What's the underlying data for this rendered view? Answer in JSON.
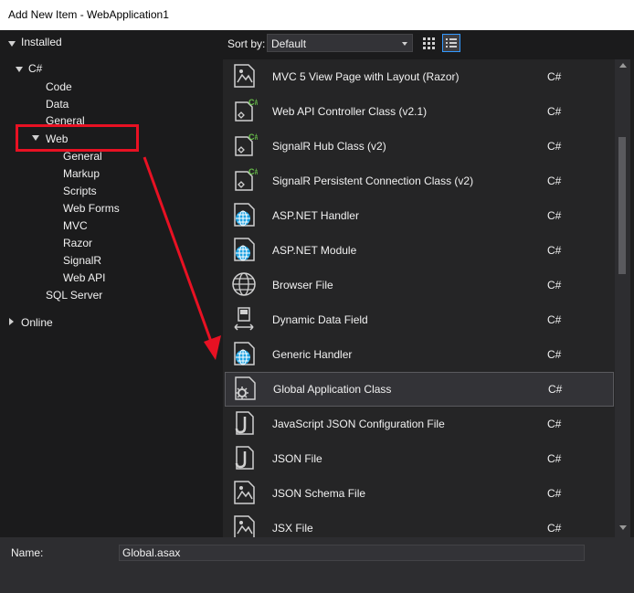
{
  "window": {
    "title": "Add New Item - WebApplication1"
  },
  "tree": {
    "installed": "Installed",
    "csharp": "C#",
    "code": "Code",
    "data": "Data",
    "general": "General",
    "web": "Web",
    "web_children": [
      "General",
      "Markup",
      "Scripts",
      "Web Forms",
      "MVC",
      "Razor",
      "SignalR",
      "Web API"
    ],
    "sql_server": "SQL Server",
    "online": "Online"
  },
  "toolbar": {
    "sort_label": "Sort by:",
    "sort_value": "Default"
  },
  "items": [
    {
      "name": "MVC 5 View Page with Layout (Razor)",
      "lang": "C#",
      "icon": "razor-page-icon"
    },
    {
      "name": "Web API Controller Class (v2.1)",
      "lang": "C#",
      "icon": "csharp-class-icon"
    },
    {
      "name": "SignalR Hub Class (v2)",
      "lang": "C#",
      "icon": "csharp-class-icon"
    },
    {
      "name": "SignalR Persistent Connection Class (v2)",
      "lang": "C#",
      "icon": "csharp-class-icon"
    },
    {
      "name": "ASP.NET Handler",
      "lang": "C#",
      "icon": "globe-page-icon"
    },
    {
      "name": "ASP.NET Module",
      "lang": "C#",
      "icon": "globe-page-icon"
    },
    {
      "name": "Browser File",
      "lang": "C#",
      "icon": "globe-icon"
    },
    {
      "name": "Dynamic Data Field",
      "lang": "C#",
      "icon": "dynamic-field-icon"
    },
    {
      "name": "Generic Handler",
      "lang": "C#",
      "icon": "globe-page-icon"
    },
    {
      "name": "Global Application Class",
      "lang": "C#",
      "icon": "gear-page-icon"
    },
    {
      "name": "JavaScript JSON Configuration File",
      "lang": "C#",
      "icon": "json-file-icon"
    },
    {
      "name": "JSON File",
      "lang": "C#",
      "icon": "json-file-icon"
    },
    {
      "name": "JSON Schema File",
      "lang": "C#",
      "icon": "razor-page-icon"
    },
    {
      "name": "JSX File",
      "lang": "C#",
      "icon": "razor-page-icon"
    }
  ],
  "bottom": {
    "name_label": "Name:",
    "name_value": "Global.asax"
  },
  "colors": {
    "accent": "#e81123",
    "selection": "#333337",
    "csharp_badge": "#68c04a",
    "globe": "#1ba1e2"
  }
}
